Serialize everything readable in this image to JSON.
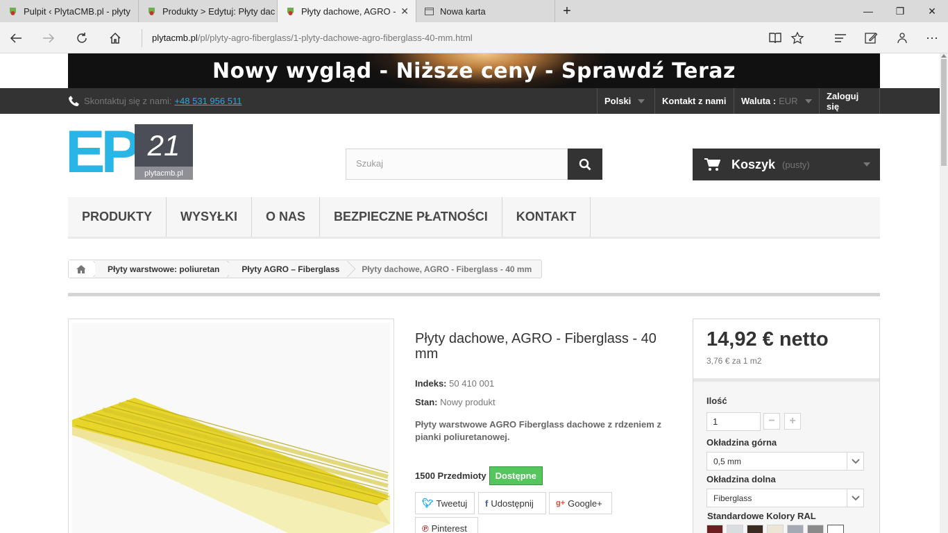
{
  "browser": {
    "tabs": [
      {
        "title": "Pulpit ‹ PlytaCMB.pl - płyty"
      },
      {
        "title": "Produkty > Edytuj: Płyty dac"
      },
      {
        "title": "Płyty dachowe, AGRO -"
      },
      {
        "title": "Nowa karta"
      }
    ],
    "url_host": "plytacmb.pl",
    "url_path": "/pl/plyty-agro-fiberglass/1-plyty-dachowe-agro-fiberglass-40-mm.html"
  },
  "banner": {
    "text": "Nowy wygląd - Niższe ceny - Sprawdź Teraz"
  },
  "topnav": {
    "contact_label": "Skontaktuj się z nami:",
    "phone": "+48 531 956 511",
    "language": "Polski",
    "contact_us": "Kontakt z nami",
    "currency_label": "Waluta :",
    "currency_value": "EUR",
    "login": "Zaloguj się"
  },
  "logo": {
    "letters": "EP",
    "number": "21",
    "domain": "plytacmb.pl"
  },
  "search": {
    "placeholder": "Szukaj"
  },
  "cart": {
    "label": "Koszyk",
    "status": "(pusty)"
  },
  "menu": [
    "PRODUKTY",
    "WYSYŁKI",
    "O NAS",
    "BEZPIECZNE PŁATNOŚCI",
    "KONTAKT"
  ],
  "breadcrumb": [
    "Płyty warstwowe: poliuretan",
    "Płyty AGRO – Fiberglass",
    "Płyty dachowe, AGRO - Fiberglass - 40 mm"
  ],
  "product": {
    "title": "Płyty dachowe, AGRO - Fiberglass - 40 mm",
    "ref_label": "Indeks:",
    "ref_value": "50 410 001",
    "cond_label": "Stan:",
    "cond_value": "Nowy produkt",
    "description": "Płyty warstwowe AGRO Fiberglass dachowe z rdzeniem z pianki poliuretanowej.",
    "quantity_text": "1500 Przedmioty",
    "availability": "Dostępne"
  },
  "share": {
    "tweet": "Tweetuj",
    "facebook": "Udostępnij",
    "google": "Google+",
    "pinterest": "Pinterest"
  },
  "buybox": {
    "price": "14,92 € netto",
    "unit_price": "3,76 € za 1 m2",
    "qty_label": "Ilość",
    "qty_value": "1",
    "top_cover_label": "Okładzina górna",
    "top_cover_value": "0,5 mm",
    "bottom_cover_label": "Okładzina dolna",
    "bottom_cover_value": "Fiberglass",
    "colors_label": "Standardowe Kolory RAL",
    "swatches": [
      "#6b1f1f",
      "#d9dde0",
      "#3a2a22",
      "#ece6d6",
      "#a5a9b3",
      "#8a8a8a",
      "#ffffff"
    ]
  }
}
